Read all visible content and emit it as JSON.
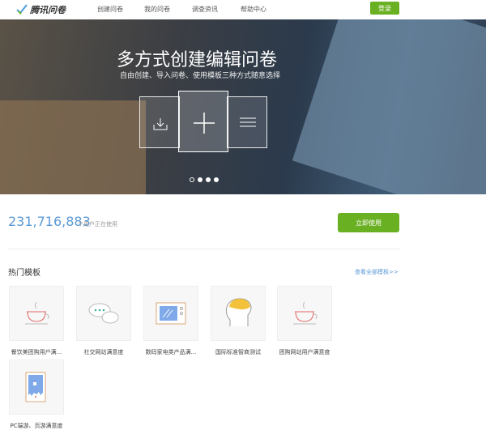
{
  "nav": {
    "logo": "腾讯问卷",
    "items": [
      "创建问卷",
      "我的问卷",
      "调查资讯",
      "帮助中心"
    ],
    "login": "登录"
  },
  "banner": {
    "title": "多方式创建编辑问卷",
    "subtitle": "自由创建、导入问卷、使用模板三种方式随意选择",
    "slides": 4,
    "active_slide": 2
  },
  "stats": {
    "count": "231,716,883",
    "count_label": "个用户正在使用",
    "cta": "立即使用"
  },
  "templates": {
    "heading": "热门模板",
    "view_all": "查看全部模板>>",
    "items": [
      {
        "label": "餐饮美团购用户满...",
        "icon": "coffee-cup-icon"
      },
      {
        "label": "社交网站满意度",
        "icon": "chat-bubbles-icon"
      },
      {
        "label": "数码家电类产品满...",
        "icon": "microwave-icon"
      },
      {
        "label": "国际标准智商测试",
        "icon": "brain-head-icon"
      },
      {
        "label": "团购网站用户满意度",
        "icon": "coffee-cup-icon"
      },
      {
        "label": "PC端游、页游满意度",
        "icon": "game-screen-icon"
      }
    ]
  },
  "colors": {
    "brand": "#6ab023",
    "link": "#5b9ad6"
  }
}
